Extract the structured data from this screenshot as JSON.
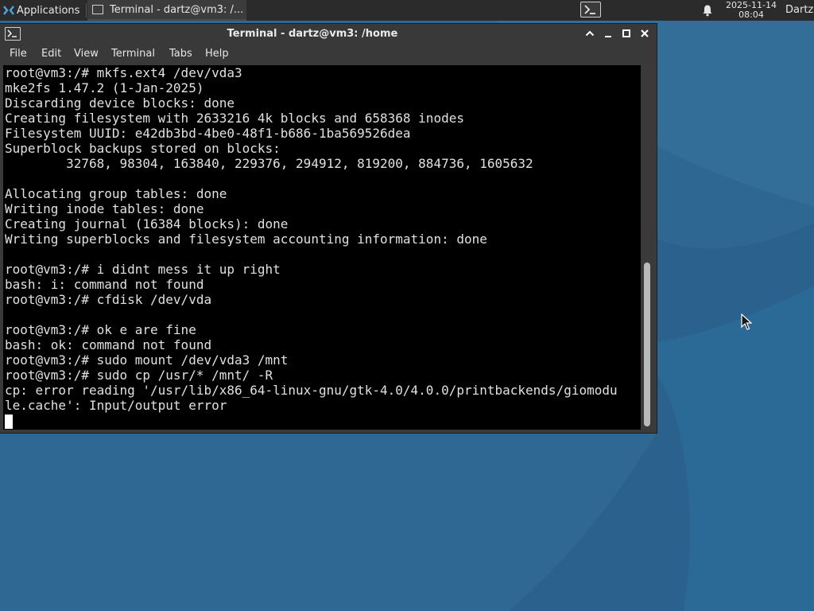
{
  "panel": {
    "applications_label": "Applications",
    "task_label": "Terminal - dartz@vm3: /...",
    "clock_date": "2025-11-14",
    "clock_time": "08:04",
    "user_label": "Dartz"
  },
  "window": {
    "title": "Terminal - dartz@vm3: /home",
    "menu": [
      "File",
      "Edit",
      "View",
      "Terminal",
      "Tabs",
      "Help"
    ]
  },
  "terminal": {
    "lines": [
      "root@vm3:/# mkfs.ext4 /dev/vda3",
      "mke2fs 1.47.2 (1-Jan-2025)",
      "Discarding device blocks: done",
      "Creating filesystem with 2633216 4k blocks and 658368 inodes",
      "Filesystem UUID: e42db3bd-4be0-48f1-b686-1ba569526dea",
      "Superblock backups stored on blocks:",
      "        32768, 98304, 163840, 229376, 294912, 819200, 884736, 1605632",
      "",
      "Allocating group tables: done",
      "Writing inode tables: done",
      "Creating journal (16384 blocks): done",
      "Writing superblocks and filesystem accounting information: done",
      "",
      "root@vm3:/# i didnt mess it up right",
      "bash: i: command not found",
      "root@vm3:/# cfdisk /dev/vda",
      "",
      "root@vm3:/# ok e are fine",
      "bash: ok: command not found",
      "root@vm3:/# sudo mount /dev/vda3 /mnt",
      "root@vm3:/# sudo cp /usr/* /mnt/ -R",
      "cp: error reading '/usr/lib/x86_64-linux-gnu/gtk-4.0/4.0.0/printbackends/giomodu",
      "le.cache': Input/output error"
    ]
  },
  "colors": {
    "panel_bg": "#2b2b2b",
    "window_bg": "#393939",
    "terminal_bg": "#000000",
    "terminal_fg": "#e0e0e0",
    "desktop_bg": "#2b6591"
  }
}
